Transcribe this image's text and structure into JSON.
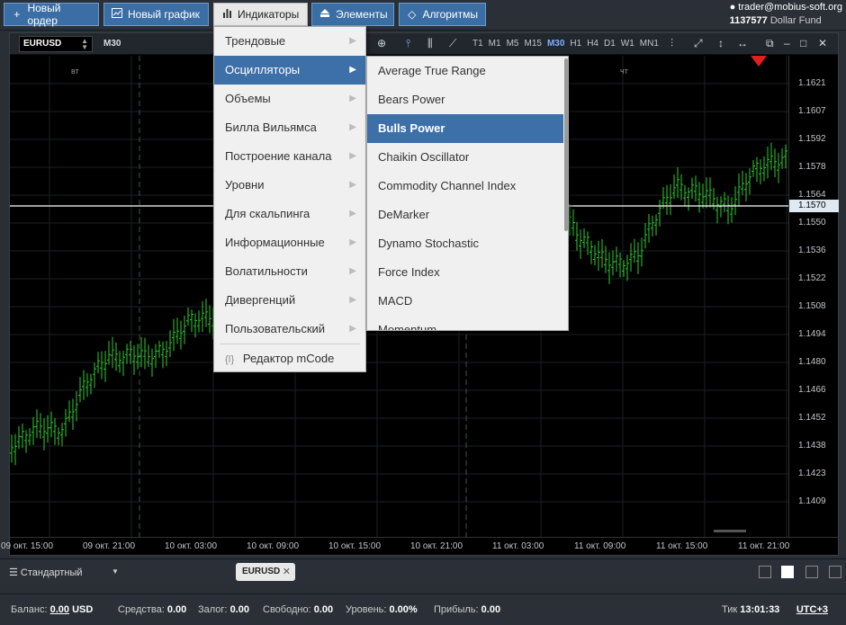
{
  "toolbar": {
    "new_order": "Новый ордер",
    "new_chart": "Новый график",
    "indicators": "Индикаторы",
    "elements": "Элементы",
    "algorithms": "Алгоритмы"
  },
  "user": {
    "email": "trader@mobius-soft.org",
    "account": "1137577",
    "account_name": "Dollar Fund"
  },
  "chart": {
    "symbol": "EURUSD",
    "timeframe": "M30",
    "timeframes": [
      "T1",
      "M1",
      "M5",
      "M15",
      "M30",
      "H1",
      "H4",
      "D1",
      "W1",
      "MN1"
    ],
    "active_timeframe": "M30",
    "day_labels": [
      "вт",
      "чт"
    ],
    "current_price": "1.1570",
    "price_labels": [
      "1.1621",
      "1.1607",
      "1.1592",
      "1.1578",
      "1.1564",
      "1.1550",
      "1.1536",
      "1.1522",
      "1.1508",
      "1.1494",
      "1.1480",
      "1.1466",
      "1.1452",
      "1.1438",
      "1.1423",
      "1.1409"
    ],
    "time_labels": [
      "09 окт. 15:00",
      "09 окт. 21:00",
      "10 окт. 03:00",
      "10 окт. 09:00",
      "10 окт. 15:00",
      "10 окт. 21:00",
      "11 окт. 03:00",
      "11 окт. 09:00",
      "11 окт. 15:00",
      "11 окт. 21:00"
    ],
    "colors": {
      "candle": "#2ecc2e",
      "price_line": "#ffffff",
      "marker": "#e21e1e"
    }
  },
  "menu_indicators": {
    "items": [
      {
        "label": "Трендовые"
      },
      {
        "label": "Осцилляторы"
      },
      {
        "label": "Объемы"
      },
      {
        "label": "Билла Вильямса"
      },
      {
        "label": "Построение канала"
      },
      {
        "label": "Уровни"
      },
      {
        "label": "Для скальпинга"
      },
      {
        "label": "Информационные"
      },
      {
        "label": "Волатильности"
      },
      {
        "label": "Дивергенций"
      },
      {
        "label": "Пользовательский"
      }
    ],
    "selected_index": 1,
    "editor": "Редактор mCode"
  },
  "menu_oscillators": {
    "items": [
      {
        "label": "Average True Range"
      },
      {
        "label": "Bears Power"
      },
      {
        "label": "Bulls Power"
      },
      {
        "label": "Chaikin Oscillator"
      },
      {
        "label": "Commodity Channel Index"
      },
      {
        "label": "DeMarker"
      },
      {
        "label": "Dynamo Stochastic"
      },
      {
        "label": "Force Index"
      },
      {
        "label": "MACD"
      },
      {
        "label": "Momentum"
      }
    ],
    "selected_index": 2
  },
  "tabs": {
    "workspace": "Стандартный",
    "open_tab": "EURUSD"
  },
  "status": {
    "balance_label": "Баланс:",
    "balance_value": "0.00",
    "balance_currency": "USD",
    "funds_label": "Средства:",
    "funds_value": "0.00",
    "margin_label": "Залог:",
    "margin_value": "0.00",
    "free_label": "Свободно:",
    "free_value": "0.00",
    "level_label": "Уровень:",
    "level_value": "0.00%",
    "profit_label": "Прибыль:",
    "profit_value": "0.00",
    "tick_label": "Тик",
    "tick_time": "13:01:33",
    "timezone": "UTC+3"
  }
}
